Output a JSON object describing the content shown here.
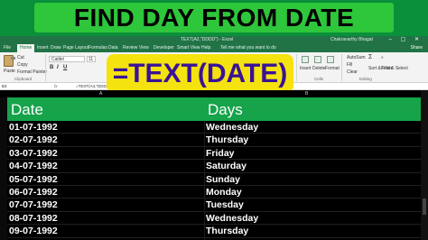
{
  "banner": {
    "title": "FIND DAY FROM DATE"
  },
  "titlebar": {
    "doc": "TEXT(A2,\"DDDD\") - Excel",
    "user": "Chakravarthy Bhagat"
  },
  "ribbon_tabs": [
    "File",
    "Home",
    "Insert",
    "Draw",
    "Page Layout",
    "Formulas",
    "Data",
    "Review",
    "View",
    "Developer",
    "Smart View",
    "Help",
    "Tell me what you want to do"
  ],
  "active_tab": "Home",
  "share_label": "Share",
  "ribbon": {
    "paste": "Paste",
    "cut": "Cut",
    "copy": "Copy",
    "format_painter": "Format Painter",
    "clipboard": "Clipboard",
    "font_name": "Calibri",
    "font_size": "11",
    "bold": "B",
    "italic": "I",
    "underline": "U",
    "insert": "Insert",
    "delete": "Delete",
    "format": "Format",
    "cells": "Cells",
    "autosum": "AutoSum",
    "fill": "Fill",
    "clear": "Clear",
    "sort_filter": "Sort & Filter",
    "find_select": "Find & Select",
    "editing": "Editing"
  },
  "overlay": {
    "formula": "=TEXT(DATE)"
  },
  "formula_bar": {
    "name_box": "B3",
    "fx": "fx",
    "content": "=TEXT(A4,\"DDDD\")"
  },
  "columns": [
    "A",
    "B"
  ],
  "table": {
    "headers": {
      "date": "Date",
      "days": "Days"
    },
    "rows": [
      {
        "date": "01-07-1992",
        "day": "Wednesday"
      },
      {
        "date": "02-07-1992",
        "day": "Thursday"
      },
      {
        "date": "03-07-1992",
        "day": "Friday"
      },
      {
        "date": "04-07-1992",
        "day": "Saturday"
      },
      {
        "date": "05-07-1992",
        "day": "Sunday"
      },
      {
        "date": "06-07-1992",
        "day": "Monday"
      },
      {
        "date": "07-07-1992",
        "day": "Tuesday"
      },
      {
        "date": "08-07-1992",
        "day": "Wednesday"
      },
      {
        "date": "09-07-1992",
        "day": "Thursday"
      }
    ]
  },
  "colors": {
    "banner_bg": "#0a8f3a",
    "banner_box": "#2ec63b",
    "excel_green": "#217346",
    "header_row": "#16a34a",
    "formula_pill": "#f5e30f",
    "formula_text": "#3a1296"
  }
}
